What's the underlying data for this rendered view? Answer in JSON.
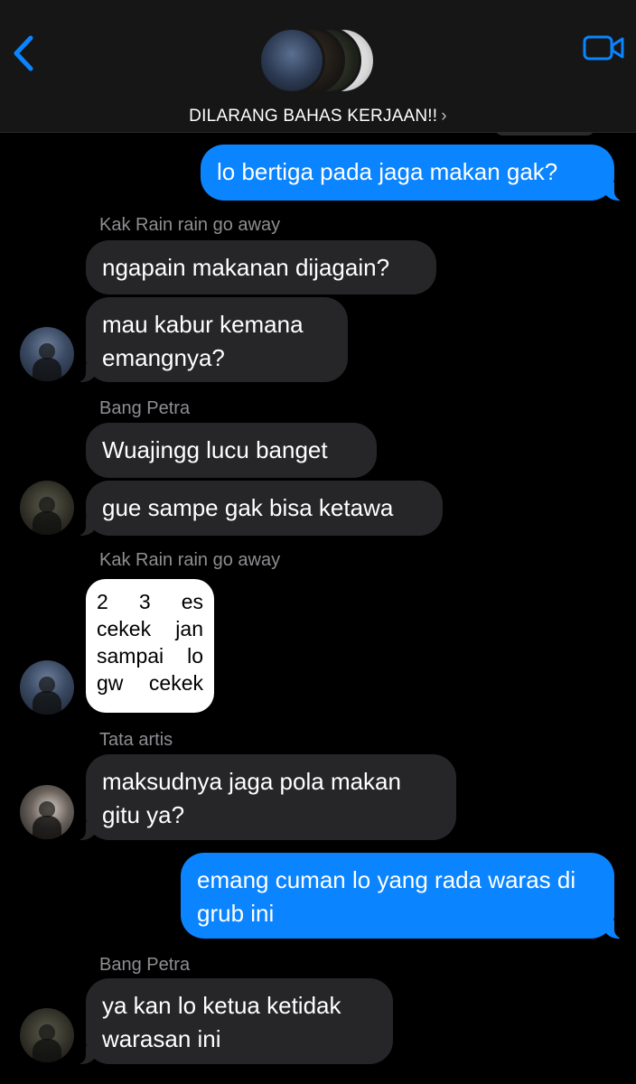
{
  "header": {
    "back_icon": "chevron-left-icon",
    "video_icon": "video-camera-icon",
    "group_name": "DILARANG BAHAS KERJAAN!!",
    "title_chevron": "›",
    "accent_color": "#0a84ff"
  },
  "messages": [
    {
      "text": "lo bertiga pada jaga makan gak?"
    },
    {
      "sender": "Kak Rain rain go away"
    },
    {
      "text": "ngapain makanan dijagain?"
    },
    {
      "text": "mau kabur kemana emangnya?"
    },
    {
      "sender": "Bang Petra"
    },
    {
      "text": "Wuajingg lucu banget"
    },
    {
      "text": "gue sampe gak bisa ketawa"
    },
    {
      "sender": "Kak Rain rain go away"
    },
    {
      "sticker_lines": [
        [
          "2",
          "3",
          "es"
        ],
        [
          "cekek",
          "jan"
        ],
        [
          "sampai",
          "lo"
        ],
        [
          "gw",
          "cekek"
        ]
      ]
    },
    {
      "sender": "Tata artis"
    },
    {
      "text": "maksudnya jaga pola makan gitu ya?"
    },
    {
      "text": "emang cuman lo yang rada waras di grub ini"
    },
    {
      "sender": "Bang Petra"
    },
    {
      "text": "ya kan lo ketua ketidak warasan ini"
    }
  ],
  "colors": {
    "outgoing_bubble": "#0a84ff",
    "incoming_bubble": "#262628",
    "background": "#000000"
  }
}
